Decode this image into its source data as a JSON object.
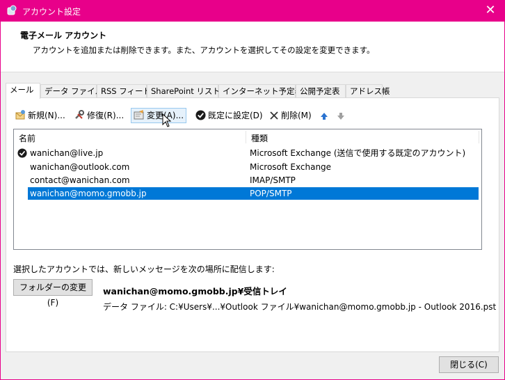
{
  "window": {
    "title": "アカウント設定",
    "close_label": "✕"
  },
  "header": {
    "title": "電子メール アカウント",
    "description": "アカウントを追加または削除できます。また、アカウントを選択してその設定を変更できます。"
  },
  "tabs": [
    {
      "label": "メール",
      "active": true
    },
    {
      "label": "データ ファイル"
    },
    {
      "label": "RSS フィード"
    },
    {
      "label": "SharePoint リスト"
    },
    {
      "label": "インターネット予定表"
    },
    {
      "label": "公開予定表"
    },
    {
      "label": "アドレス帳"
    }
  ],
  "toolbar": {
    "new_label": "新規(N)...",
    "repair_label": "修復(R)...",
    "change_label": "変更(A)...",
    "set_default_label": "既定に設定(D)",
    "remove_label": "削除(M)"
  },
  "list": {
    "columns": [
      "名前",
      "種類"
    ],
    "rows": [
      {
        "name": "wanichan@live.jp",
        "type": "Microsoft Exchange (送信で使用する既定のアカウント)",
        "default": true
      },
      {
        "name": "wanichan@outlook.com",
        "type": "Microsoft Exchange"
      },
      {
        "name": "contact@wanichan.com",
        "type": "IMAP/SMTP"
      },
      {
        "name": "wanichan@momo.gmobb.jp",
        "type": "POP/SMTP",
        "selected": true
      }
    ]
  },
  "delivery": {
    "label": "選択したアカウントでは、新しいメッセージを次の場所に配信します:",
    "change_folder_label": "フォルダーの変更(F)",
    "folder": "wanichan@momo.gmobb.jp¥受信トレイ",
    "data_file": "データ ファイル: C:¥Users¥...¥Outlook ファイル¥wanichan@momo.gmobb.jp - Outlook 2016.pst"
  },
  "footer": {
    "close_label": "閉じる(C)"
  },
  "colors": {
    "titlebar": "#e8008a",
    "selection": "#0078d7"
  }
}
